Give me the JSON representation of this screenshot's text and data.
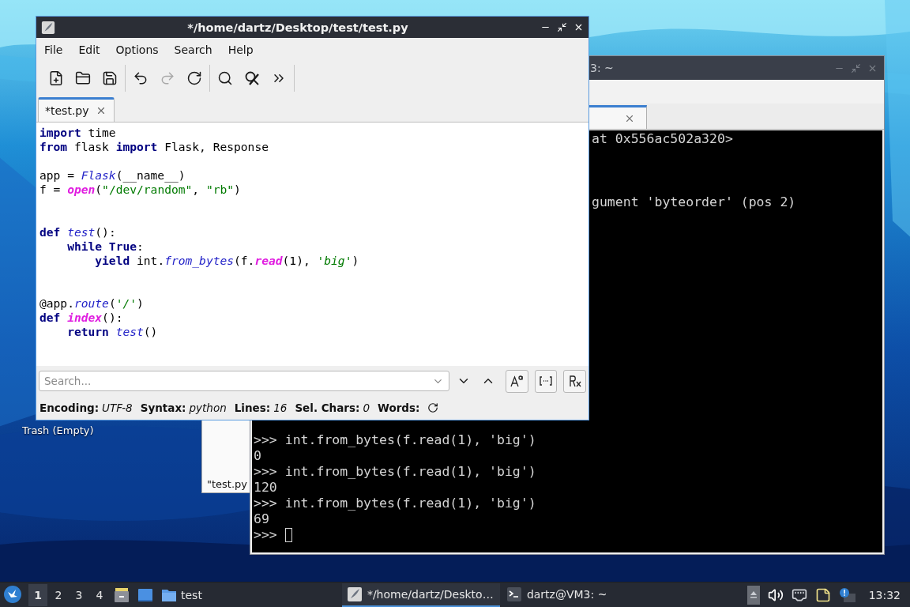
{
  "desktop": {
    "icons": [
      {
        "label": "Trash (Empty)"
      }
    ]
  },
  "background_window": {
    "label": "\"test.py"
  },
  "terminal": {
    "title": "3: ~",
    "top_lines": [
      "at 0x556ac502a320>",
      "gument 'byteorder' (pos 2)"
    ],
    "lines": [
      ">>> int.from_bytes(f.read(1), 'big')",
      "0",
      ">>> int.from_bytes(f.read(1), 'big')",
      "120",
      ">>> int.from_bytes(f.read(1), 'big')",
      "69"
    ],
    "prompt": ">>>"
  },
  "editor": {
    "title": "*/home/dartz/Desktop/test/test.py",
    "menu": [
      "File",
      "Edit",
      "Options",
      "Search",
      "Help"
    ],
    "toolbar": [
      [
        {
          "disabled": false
        },
        {
          "disabled": false
        },
        {
          "disabled": false
        }
      ],
      [
        {
          "disabled": false
        },
        {
          "disabled": true
        },
        {
          "disabled": false
        }
      ],
      [
        {
          "disabled": false
        },
        {
          "disabled": false
        },
        {
          "disabled": false
        }
      ]
    ],
    "tabs": [
      {
        "label": "*test.py",
        "selected": true
      }
    ],
    "code": [
      {
        "kind": "code",
        "tokens": [
          {
            "text": "import",
            "kind": "kw"
          },
          {
            "text": " time",
            "kind": "plain"
          }
        ]
      },
      {
        "kind": "code",
        "tokens": [
          {
            "text": "from",
            "kind": "kw"
          },
          {
            "text": " flask ",
            "kind": "plain"
          },
          {
            "text": "import",
            "kind": "kw"
          },
          {
            "text": " Flask, Response",
            "kind": "plain"
          }
        ]
      },
      {
        "kind": "blank"
      },
      {
        "kind": "code",
        "tokens": [
          {
            "text": "app = ",
            "kind": "plain"
          },
          {
            "text": "Flask",
            "kind": "fn"
          },
          {
            "text": "(__name__)",
            "kind": "plain"
          }
        ]
      },
      {
        "kind": "code",
        "tokens": [
          {
            "text": "f = ",
            "kind": "plain"
          },
          {
            "text": "open",
            "kind": "builtin"
          },
          {
            "text": "(",
            "kind": "plain"
          },
          {
            "text": "\"/dev/random\"",
            "kind": "str"
          },
          {
            "text": ", ",
            "kind": "plain"
          },
          {
            "text": "\"rb\"",
            "kind": "str"
          },
          {
            "text": ")",
            "kind": "plain"
          }
        ]
      },
      {
        "kind": "blank"
      },
      {
        "kind": "blank"
      },
      {
        "kind": "code",
        "tokens": [
          {
            "text": "def ",
            "kind": "kw"
          },
          {
            "text": "test",
            "kind": "fn"
          },
          {
            "text": "():",
            "kind": "plain"
          }
        ]
      },
      {
        "kind": "code",
        "tokens": [
          {
            "text": "    while True",
            "kind": "kw"
          },
          {
            "text": ":",
            "kind": "plain"
          }
        ]
      },
      {
        "kind": "code",
        "tokens": [
          {
            "text": "        yield",
            "kind": "kw"
          },
          {
            "text": " int.",
            "kind": "plain"
          },
          {
            "text": "from_bytes",
            "kind": "fn"
          },
          {
            "text": "(f.",
            "kind": "plain"
          },
          {
            "text": "read",
            "kind": "builtin"
          },
          {
            "text": "(1), ",
            "kind": "plain"
          },
          {
            "text": "'big'",
            "kind": "sstr"
          },
          {
            "text": ")",
            "kind": "plain"
          }
        ]
      },
      {
        "kind": "blank"
      },
      {
        "kind": "blank"
      },
      {
        "kind": "code",
        "tokens": [
          {
            "text": "@app.",
            "kind": "plain"
          },
          {
            "text": "route",
            "kind": "fn"
          },
          {
            "text": "(",
            "kind": "plain"
          },
          {
            "text": "'/'",
            "kind": "sstr"
          },
          {
            "text": ")",
            "kind": "plain"
          }
        ]
      },
      {
        "kind": "code",
        "tokens": [
          {
            "text": "def ",
            "kind": "kw"
          },
          {
            "text": "index",
            "kind": "builtin"
          },
          {
            "text": "():",
            "kind": "plain"
          }
        ]
      },
      {
        "kind": "code",
        "tokens": [
          {
            "text": "    return ",
            "kind": "kw"
          },
          {
            "text": "test",
            "kind": "fn"
          },
          {
            "text": "()",
            "kind": "plain"
          }
        ]
      },
      {
        "kind": "blank"
      }
    ],
    "search": {
      "placeholder": "Search..."
    },
    "status": [
      {
        "label": "Encoding:",
        "value": "UTF-8"
      },
      {
        "label": "Syntax:",
        "value": "python"
      },
      {
        "label": "Lines:",
        "value": "16"
      },
      {
        "label": "Sel. Chars:",
        "value": "0"
      },
      {
        "label": "Words:"
      }
    ]
  },
  "taskbar": {
    "workspaces": [
      {
        "label": "1",
        "selected": true
      },
      {
        "label": "2",
        "selected": false
      },
      {
        "label": "3",
        "selected": false
      },
      {
        "label": "4",
        "selected": false
      }
    ],
    "quick_launch": {
      "label": "test"
    },
    "tasks": [
      {
        "kind": "editor",
        "label": "*/home/dartz/Deskto…",
        "selected": true
      },
      {
        "kind": "terminal",
        "label": "dartz@VM3: ~",
        "selected": false
      }
    ],
    "clock": "13:32"
  }
}
